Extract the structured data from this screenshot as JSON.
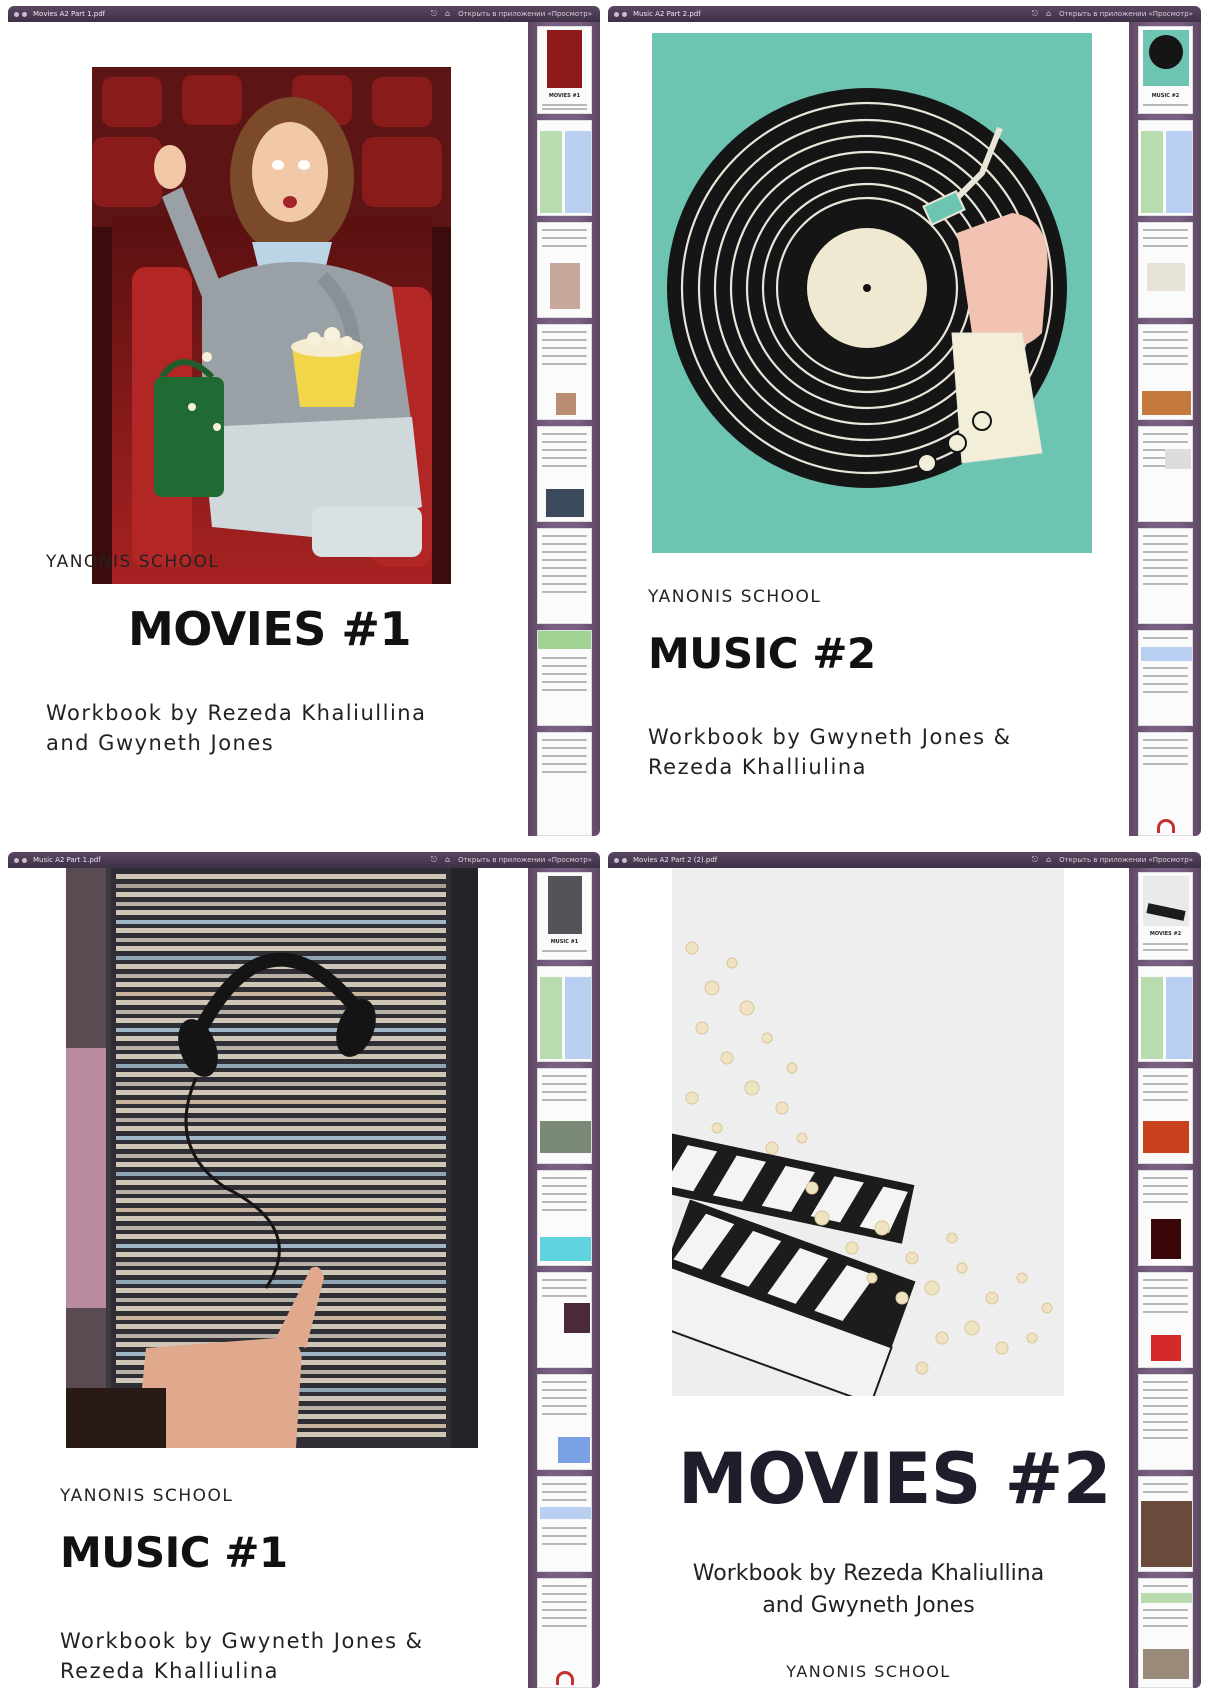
{
  "windows": [
    {
      "file_name": "Movies A2 Part 1.pdf",
      "open_in_app": "Открыть в приложении «Просмотр»",
      "school": "YANONIS SCHOOL",
      "title": "MOVIES #1",
      "byline_1": "Workbook by Rezeda Khaliullina",
      "byline_2": "and Gwyneth Jones",
      "cover": "woman-in-cinema-with-popcorn-photo",
      "thumb_title": "MOVIES #1"
    },
    {
      "file_name": "Music A2 Part 2.pdf",
      "open_in_app": "Открыть в приложении «Просмотр»",
      "school": "YANONIS SCHOOL",
      "title": "MUSIC #2",
      "byline_1": "Workbook by Gwyneth Jones &",
      "byline_2": "Rezeda Khalliulina",
      "cover": "vinyl-record-turntable-illustration",
      "thumb_title": "MUSIC #2"
    },
    {
      "file_name": "Music A2 Part 1.pdf",
      "open_in_app": "Открыть в приложении «Просмотр»",
      "school": "YANONIS SCHOOL",
      "title": "MUSIC #1",
      "byline_1": "Workbook by Gwyneth Jones &",
      "byline_2": "Rezeda Khalliulina",
      "cover": "vinyl-records-with-headphones-photo",
      "thumb_title": "MUSIC #1"
    },
    {
      "file_name": "Movies A2 Part 2 (2).pdf",
      "open_in_app": "Открыть в приложении «Просмотр»",
      "school": "YANONIS SCHOOL",
      "title": "MOVIES #2",
      "byline_1": "Workbook by Rezeda Khaliullina",
      "byline_2": "and Gwyneth Jones",
      "cover": "popcorn-and-clapperboards-photo",
      "thumb_title": "MOVIES #2"
    }
  ],
  "colors": {
    "sidebar": "#7a5f82",
    "vinyl_bg": "#6cc4b1",
    "cinema_red": "#8e1a1a",
    "clap_black": "#1c1c1c"
  }
}
